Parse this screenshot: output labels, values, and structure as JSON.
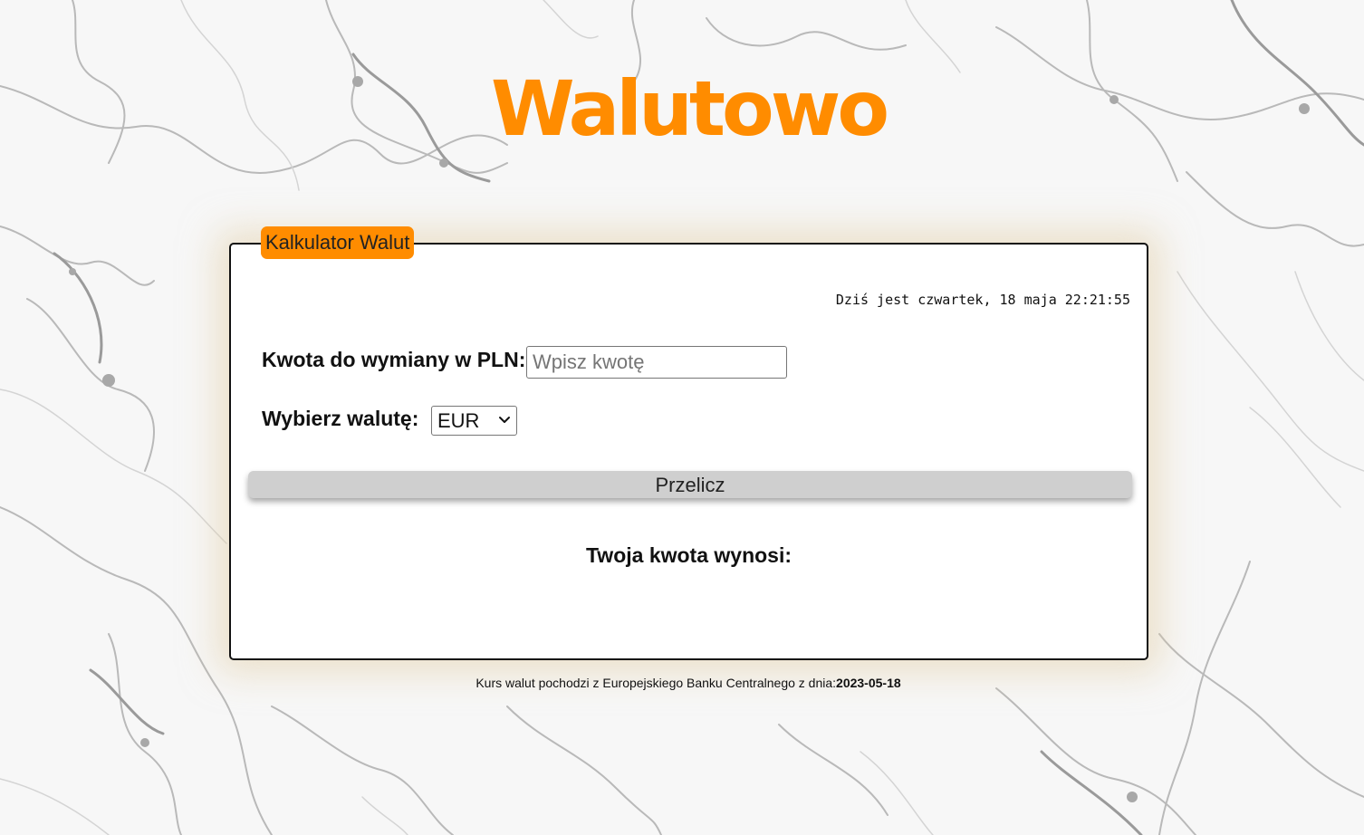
{
  "brand": {
    "title": "Walutowo",
    "accent_color": "#ff8c00"
  },
  "calculator": {
    "legend": "Kalkulator Walut",
    "date_text": "Dziś jest czwartek, 18 maja 22:21:55",
    "amount_label": "Kwota do wymiany w PLN:",
    "amount_placeholder": "Wpisz kwotę",
    "amount_value": "",
    "currency_label": "Wybierz walutę:",
    "currency_selected": "EUR",
    "currency_icon": "chevron-down-icon",
    "convert_label": "Przelicz",
    "result_label": "Twoja kwota wynosi:"
  },
  "footer": {
    "source_text": "Kurs walut pochodzi z Europejskiego Banku Centralnego z dnia:",
    "rates_date": "2023-05-18"
  }
}
